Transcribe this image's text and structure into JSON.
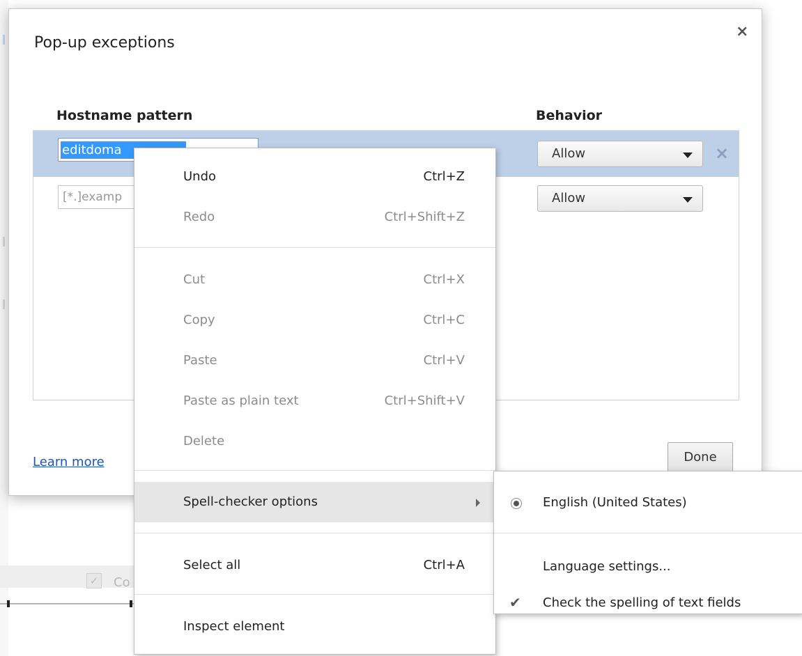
{
  "dialog": {
    "title": "Pop-up exceptions",
    "close_label": "×",
    "columns": {
      "host": "Hostname pattern",
      "behavior": "Behavior"
    },
    "rows": [
      {
        "host_value": "editdoma",
        "behavior": "Allow",
        "remove_label": "×"
      },
      {
        "host_placeholder": "[*.]examp",
        "behavior": "Allow"
      }
    ],
    "learn_more": "Learn more",
    "done": "Done"
  },
  "context_menu": {
    "items": [
      {
        "label": "Undo",
        "shortcut": "Ctrl+Z",
        "enabled": true
      },
      {
        "label": "Redo",
        "shortcut": "Ctrl+Shift+Z",
        "enabled": false
      },
      {
        "label": "Cut",
        "shortcut": "Ctrl+X",
        "enabled": false
      },
      {
        "label": "Copy",
        "shortcut": "Ctrl+C",
        "enabled": false
      },
      {
        "label": "Paste",
        "shortcut": "Ctrl+V",
        "enabled": false
      },
      {
        "label": "Paste as plain text",
        "shortcut": "Ctrl+Shift+V",
        "enabled": false
      },
      {
        "label": "Delete",
        "shortcut": "",
        "enabled": false
      },
      {
        "label": "Spell-checker options",
        "shortcut": "",
        "enabled": true,
        "highlighted": true
      },
      {
        "label": "Select all",
        "shortcut": "Ctrl+A",
        "enabled": true
      },
      {
        "label": "Inspect element",
        "shortcut": "",
        "enabled": true
      }
    ]
  },
  "submenu": {
    "items": [
      {
        "label": "English (United States)",
        "type": "radio",
        "selected": true
      },
      {
        "label": "Language settings...",
        "type": "plain"
      },
      {
        "label": "Check the spelling of text fields",
        "type": "checkbox",
        "checked": true
      }
    ]
  },
  "background": {
    "partial_label": "Co"
  },
  "colors": {
    "selection": "#3399ff",
    "row_highlight": "#bdd0e8",
    "link": "#1a55c0"
  }
}
